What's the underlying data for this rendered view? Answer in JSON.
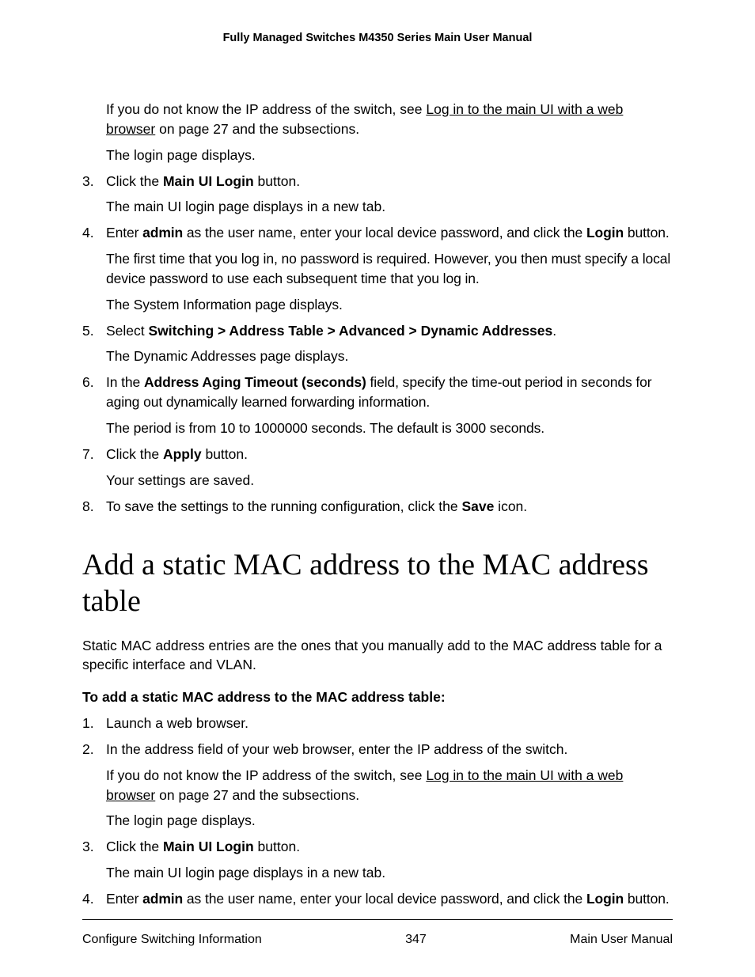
{
  "header": {
    "title": "Fully Managed Switches M4350 Series Main User Manual"
  },
  "top": {
    "p1a": "If you do not know the IP address of the switch, see ",
    "p1link": "Log in to the main UI with a web browser",
    "p1b": " on page 27 and the subsections.",
    "p2": "The login page displays."
  },
  "step3": {
    "num": "3.",
    "a": "Click the ",
    "bold": "Main UI Login",
    "b": " button.",
    "tail": "The main UI login page displays in a new tab."
  },
  "step4": {
    "num": "4.",
    "a": "Enter ",
    "bold1": "admin",
    "b": " as the user name, enter your local device password, and click the ",
    "bold2": "Login",
    "c": " button.",
    "tail1": "The first time that you log in, no password is required. However, you then must specify a local device password to use each subsequent time that you log in.",
    "tail2": "The System Information page displays."
  },
  "step5": {
    "num": "5.",
    "a": "Select ",
    "bold": "Switching > Address Table > Advanced > Dynamic Addresses",
    "b": ".",
    "tail": "The Dynamic Addresses page displays."
  },
  "step6": {
    "num": "6.",
    "a": "In the ",
    "bold": "Address Aging Timeout (seconds)",
    "b": " field, specify the time-out period in seconds for aging out dynamically learned forwarding information.",
    "tail": "The period is from 10 to 1000000 seconds. The default is 3000 seconds."
  },
  "step7": {
    "num": "7.",
    "a": "Click the ",
    "bold": "Apply",
    "b": " button.",
    "tail": "Your settings are saved."
  },
  "step8": {
    "num": "8.",
    "a": "To save the settings to the running configuration, click the ",
    "bold": "Save",
    "b": " icon."
  },
  "section2": {
    "heading": "Add a static MAC address to the MAC address table",
    "intro": "Static MAC address entries are the ones that you manually add to the MAC address table for a specific interface and VLAN.",
    "subhead": "To add a static MAC address to the MAC address table:"
  },
  "s2step1": {
    "num": "1.",
    "text": "Launch a web browser."
  },
  "s2step2": {
    "num": "2.",
    "text": "In the address field of your web browser, enter the IP address of the switch.",
    "t1a": "If you do not know the IP address of the switch, see ",
    "t1link": "Log in to the main UI with a web browser",
    "t1b": " on page 27 and the subsections.",
    "t2": "The login page displays."
  },
  "s2step3": {
    "num": "3.",
    "a": "Click the ",
    "bold": "Main UI Login",
    "b": " button.",
    "tail": "The main UI login page displays in a new tab."
  },
  "s2step4": {
    "num": "4.",
    "a": "Enter ",
    "bold1": "admin",
    "b": " as the user name, enter your local device password, and click the ",
    "bold2": "Login",
    "c": " button."
  },
  "footer": {
    "left": "Configure Switching Information",
    "center": "347",
    "right": "Main User Manual"
  }
}
